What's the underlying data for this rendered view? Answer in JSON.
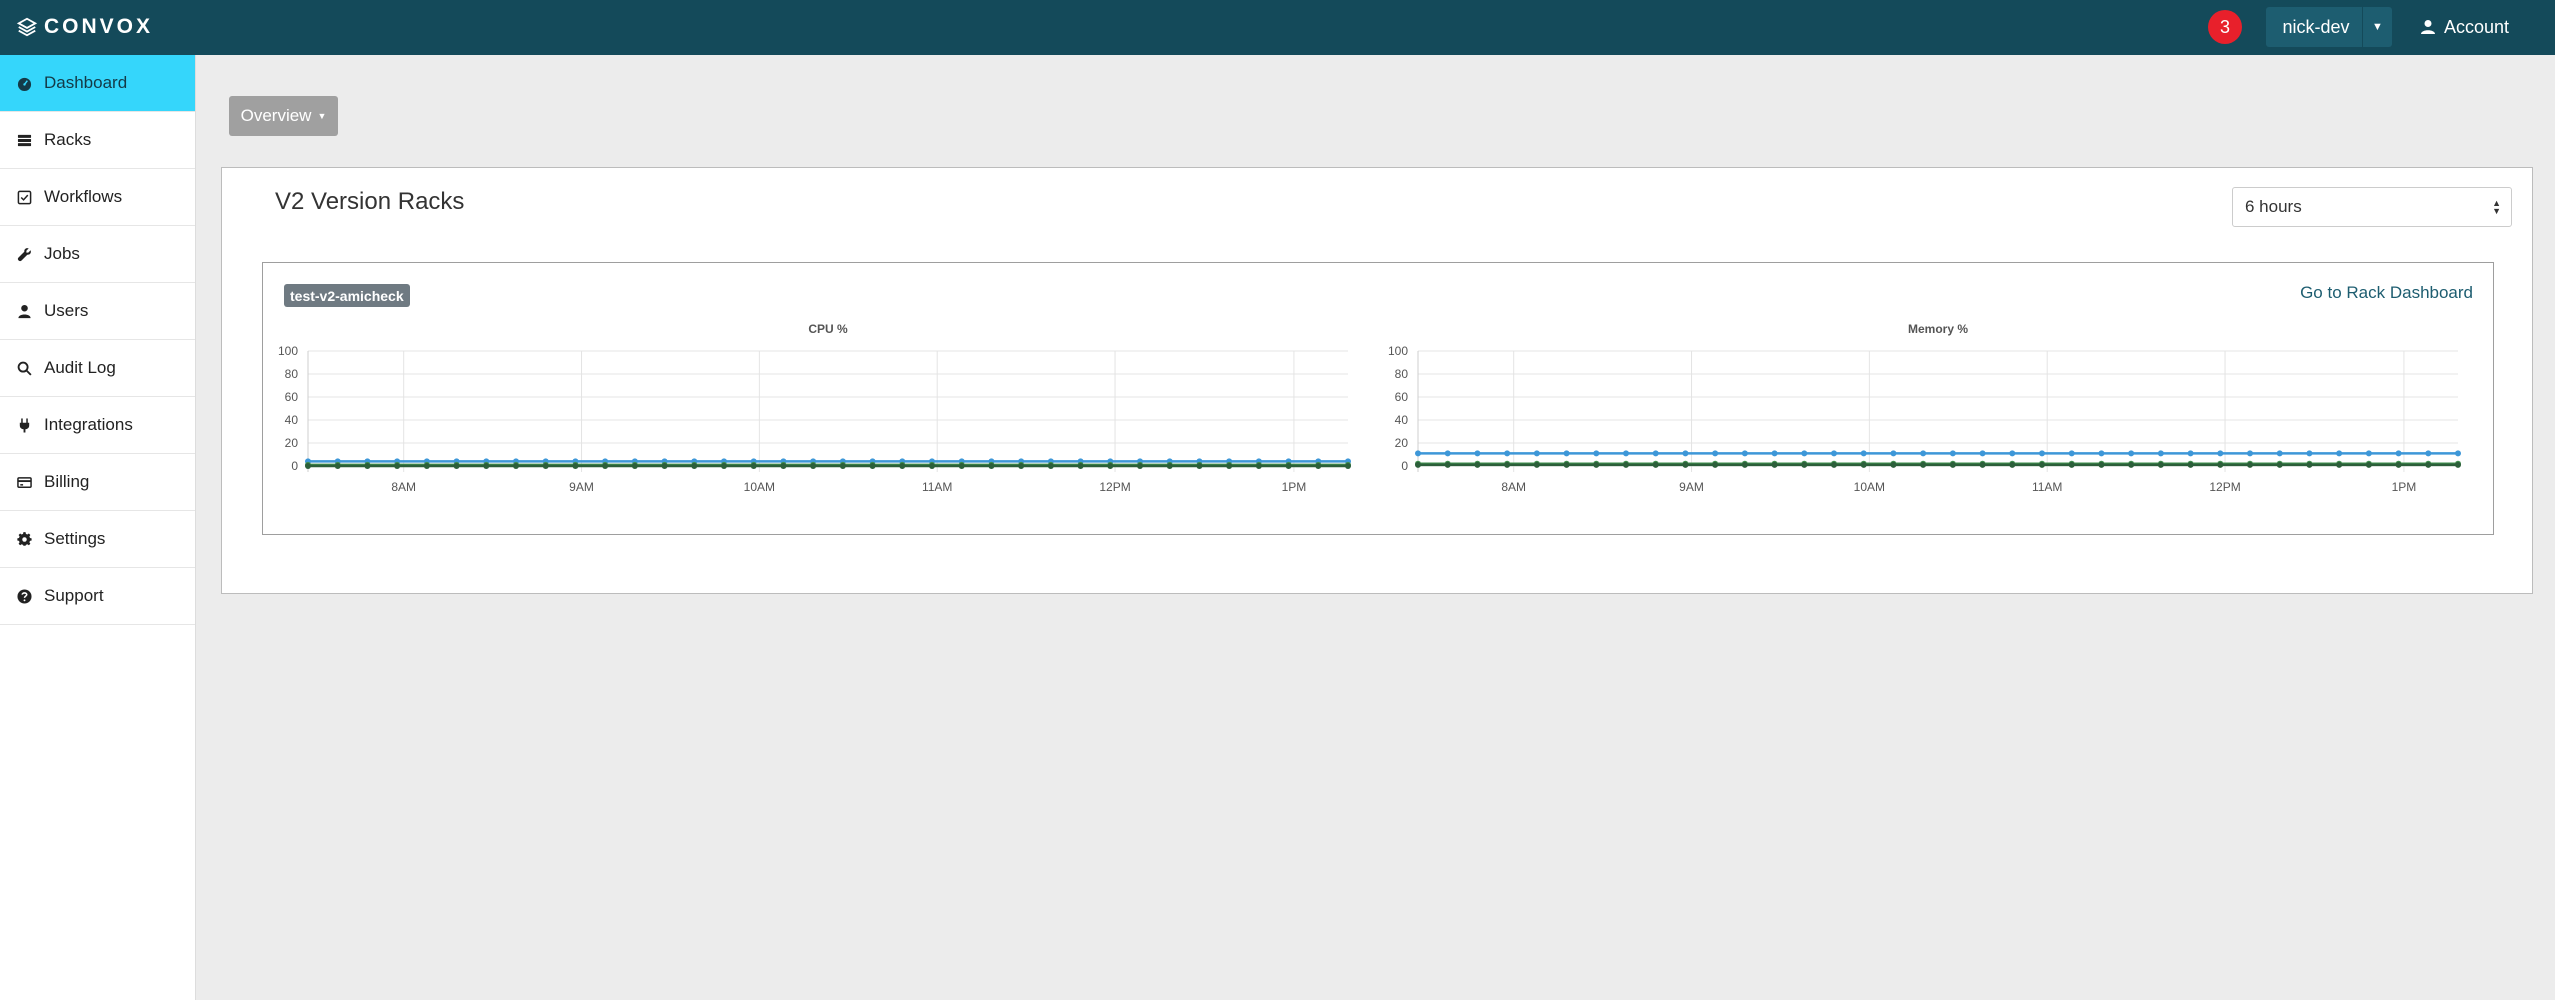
{
  "header": {
    "logo_text": "CONVOX",
    "notification_count": "3",
    "rack_name": "nick-dev",
    "account_label": "Account"
  },
  "sidebar": {
    "items": [
      {
        "label": "Dashboard",
        "icon": "dashboard-icon",
        "active": true
      },
      {
        "label": "Racks",
        "icon": "server-icon"
      },
      {
        "label": "Workflows",
        "icon": "checkbox-icon"
      },
      {
        "label": "Jobs",
        "icon": "wrench-icon"
      },
      {
        "label": "Users",
        "icon": "user-icon"
      },
      {
        "label": "Audit Log",
        "icon": "search-icon"
      },
      {
        "label": "Integrations",
        "icon": "plug-icon"
      },
      {
        "label": "Billing",
        "icon": "credit-card-icon"
      },
      {
        "label": "Settings",
        "icon": "gear-icon"
      },
      {
        "label": "Support",
        "icon": "question-circle-icon"
      }
    ]
  },
  "main": {
    "overview_label": "Overview",
    "panel_title": "V2 Version Racks",
    "time_range": "6 hours",
    "rack": {
      "name": "test-v2-amicheck",
      "link_label": "Go to Rack Dashboard"
    }
  },
  "colors": {
    "topbar": "#144a5a",
    "active_nav": "#35d6fb",
    "badge": "#e8202b",
    "series_blue": "#3d97d8",
    "series_green": "#3f8e4d",
    "series_dark": "#2c5f3a"
  },
  "chart_data": [
    {
      "type": "line",
      "title": "CPU %",
      "xlabel": "",
      "ylabel": "",
      "ylim": [
        0,
        100
      ],
      "yticks": [
        0,
        20,
        40,
        60,
        80,
        100
      ],
      "xticks": [
        "8AM",
        "9AM",
        "10AM",
        "11AM",
        "12PM",
        "1PM"
      ],
      "grid": true,
      "legend": "none",
      "point_count": 36,
      "series": [
        {
          "color": "#3d97d8",
          "values": [
            4,
            4,
            4,
            4,
            4,
            4,
            4,
            4,
            4,
            4,
            4,
            4,
            4,
            4,
            4,
            4,
            4,
            4,
            4,
            4,
            4,
            4,
            4,
            4,
            4,
            4,
            4,
            4,
            4,
            4,
            4,
            4,
            4,
            4,
            4,
            4
          ]
        },
        {
          "color": "#3f8e4d",
          "values": [
            1,
            1,
            1,
            1,
            1,
            1,
            1,
            1,
            1,
            1,
            1,
            1,
            1,
            1,
            1,
            1,
            1,
            1,
            1,
            1,
            1,
            1,
            1,
            1,
            1,
            1,
            1,
            1,
            1,
            1,
            1,
            1,
            1,
            1,
            1,
            1
          ]
        },
        {
          "color": "#2c5f3a",
          "values": [
            0,
            0,
            0,
            0,
            0,
            0,
            0,
            0,
            0,
            0,
            0,
            0,
            0,
            0,
            0,
            0,
            0,
            0,
            0,
            0,
            0,
            0,
            0,
            0,
            0,
            0,
            0,
            0,
            0,
            0,
            0,
            0,
            0,
            0,
            0,
            0
          ]
        }
      ]
    },
    {
      "type": "line",
      "title": "Memory %",
      "xlabel": "",
      "ylabel": "",
      "ylim": [
        0,
        100
      ],
      "yticks": [
        0,
        20,
        40,
        60,
        80,
        100
      ],
      "xticks": [
        "8AM",
        "9AM",
        "10AM",
        "11AM",
        "12PM",
        "1PM"
      ],
      "grid": true,
      "legend": "none",
      "point_count": 36,
      "series": [
        {
          "color": "#3d97d8",
          "values": [
            11,
            11,
            11,
            11,
            11,
            11,
            11,
            11,
            11,
            11,
            11,
            11,
            11,
            11,
            11,
            11,
            11,
            11,
            11,
            11,
            11,
            11,
            11,
            11,
            11,
            11,
            11,
            11,
            11,
            11,
            11,
            11,
            11,
            11,
            11,
            11
          ]
        },
        {
          "color": "#3f8e4d",
          "values": [
            2,
            2,
            2,
            2,
            2,
            2,
            2,
            2,
            2,
            2,
            2,
            2,
            2,
            2,
            2,
            2,
            2,
            2,
            2,
            2,
            2,
            2,
            2,
            2,
            2,
            2,
            2,
            2,
            2,
            2,
            2,
            2,
            2,
            2,
            2,
            2
          ]
        },
        {
          "color": "#2c5f3a",
          "values": [
            1,
            1,
            1,
            1,
            1,
            1,
            1,
            1,
            1,
            1,
            1,
            1,
            1,
            1,
            1,
            1,
            1,
            1,
            1,
            1,
            1,
            1,
            1,
            1,
            1,
            1,
            1,
            1,
            1,
            1,
            1,
            1,
            1,
            1,
            1,
            1
          ]
        }
      ]
    }
  ]
}
